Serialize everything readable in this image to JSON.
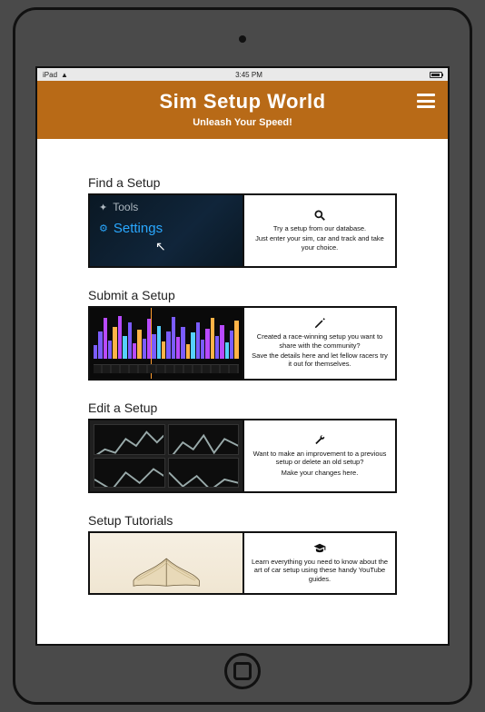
{
  "status": {
    "carrier": "iPad",
    "time": "3:45 PM"
  },
  "header": {
    "title": "Sim Setup World",
    "subtitle": "Unleash Your Speed!"
  },
  "cards": [
    {
      "title": "Find a Setup",
      "icon": "search",
      "lines": [
        "Try a setup from our database.",
        "Just enter your sim, car and track and take your choice."
      ],
      "thumb_label_top": "Tools",
      "thumb_label_main": "Settings"
    },
    {
      "title": "Submit a Setup",
      "icon": "pencil",
      "lines": [
        "Created a race-winning setup you want to share with the community?",
        "Save the details here and let fellow racers try it out for themselves."
      ]
    },
    {
      "title": "Edit a Setup",
      "icon": "wrench",
      "lines": [
        "Want to make an improvement to a previous setup or delete an old setup?",
        "Make your changes here."
      ]
    },
    {
      "title": "Setup Tutorials",
      "icon": "graduation",
      "lines": [
        "Learn everything you need to know about the art of car setup using these handy YouTube guides."
      ]
    }
  ]
}
